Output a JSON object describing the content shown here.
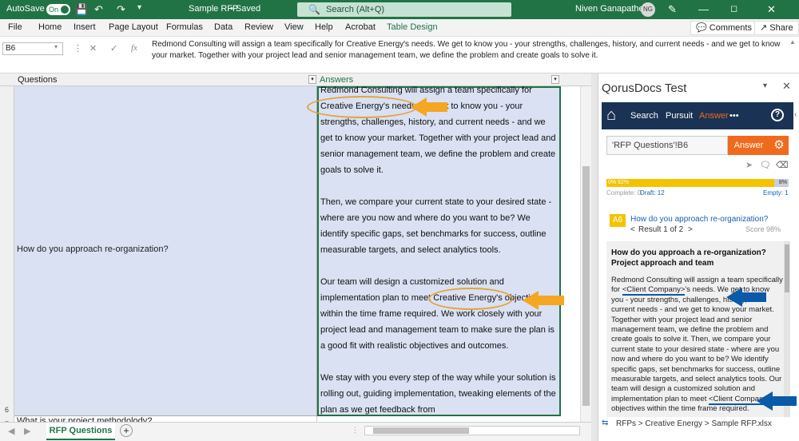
{
  "titlebar": {
    "autosave_label": "AutoSave",
    "autosave_state": "On",
    "doc_title": "Sample RFP",
    "saved_label": "• Saved",
    "search_placeholder": "Search (Alt+Q)",
    "user_name": "Niven Ganapathee",
    "user_initials": "NG"
  },
  "menu": {
    "items": [
      "File",
      "Home",
      "Insert",
      "Page Layout",
      "Formulas",
      "Data",
      "Review",
      "View",
      "Help",
      "Acrobat",
      "Table Design"
    ],
    "comments_label": "Comments",
    "share_label": "Share"
  },
  "formula_bar": {
    "name_box": "B6",
    "content": "Redmond Consulting will assign a team specifically for Creative Energy's needs. We get to know you - your strengths, challenges, history, and current needs - and we get to know your market. Together with your project lead and senior management team, we define the problem and create goals to solve it."
  },
  "sheet": {
    "col_a_header": "Questions",
    "col_b_header": "Answers",
    "row_numbers": [
      "6",
      "7"
    ],
    "question_a6": "How do you approach re-organization?",
    "question_a7": "What is your project methodolody?",
    "answer_paragraphs": [
      "Redmond Consulting will assign a team specifically for Creative Energy's needs. We get to know you - your strengths, challenges, history, and current needs - and we get to know your market. Together with your project lead and senior management team, we define the problem and create goals to solve it.",
      "Then, we compare your current state to your desired state - where are you now and where do you want to be? We identify specific gaps, set benchmarks for success, outline measurable targets, and select analytics tools.",
      "Our team will design a customized solution and implementation plan to meet Creative Energy's objectives within the time frame required. We work closely with your project lead and management team to make sure the plan is a good fit with realistic objectives and outcomes.",
      "We stay with you every step of the way while your solution is rolling out, guiding implementation, tweaking elements of the plan as we get feedback from"
    ],
    "tab_name": "RFP Questions"
  },
  "pane": {
    "title": "QorusDocs Test",
    "nav": {
      "search": "Search",
      "pursuit": "Pursuit",
      "answer": "Answer",
      "more": "•••"
    },
    "cell_ref": "'RFP Questions'!B6",
    "answer_button": "Answer",
    "progress": {
      "fill_fraction": 0.92,
      "left_label": "0% 92%",
      "right_label": "8%",
      "complete": "Complete: 0",
      "draft": "Draft: 12",
      "empty": "Empty: 1"
    },
    "question": {
      "id": "A6",
      "text": "How do you approach re-organization?",
      "result": "Result 1 of 2",
      "score": "Score 98%"
    },
    "result": {
      "heading": "How do you approach a re-organization? Project approach and team",
      "body_1": "Redmond Consulting will assign a team specifically for ",
      "placeholder": "<Client Company>",
      "body_2": "'s needs. We get to know you - your strengths, challenges, history, and current needs - and we get to know your market. Together with your project lead and senior management team, we define the problem and create goals to solve it. Then, we compare your current state to your desired state - where are you now and where do you want to be? We identify specific gaps, set benchmarks for success, outline measurable targets, and select analytics tools. Our team will design a customized solution and implementation plan to meet ",
      "placeholder_2": "<Client Company>",
      "body_3": "'s objectives within the time frame required."
    },
    "breadcrumb": "RFPs > Creative Energy > Sample RFP.xlsx"
  },
  "colors": {
    "excel_green": "#217346",
    "selection_blue": "#d9e1f2",
    "qorus_navy": "#1a3354",
    "accent_orange": "#f06a1d",
    "progress_yellow": "#f5c200",
    "annotation_orange": "#f5a623",
    "annotation_blue": "#0a5aa8"
  }
}
